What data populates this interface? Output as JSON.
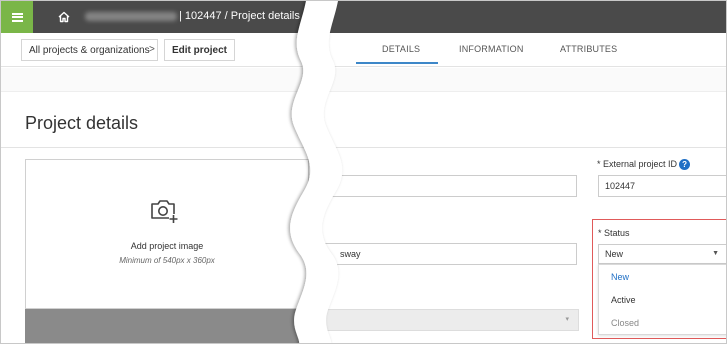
{
  "topbar": {
    "breadcrumb_text": "| 102447  /  Project details"
  },
  "nav": {
    "back_link": "All projects & organizations",
    "chevron": ">",
    "edit_project": "Edit project",
    "tabs": [
      {
        "label": "DETAILS",
        "active": true
      },
      {
        "label": "INFORMATION",
        "active": false
      },
      {
        "label": "ATTRIBUTES",
        "active": false
      }
    ]
  },
  "section": {
    "title": "Project details"
  },
  "image_panel": {
    "add_label": "Add project image",
    "min_size": "Minimum of 540px x 360px",
    "icon": "camera-plus-icon"
  },
  "fields": {
    "external_id": {
      "label": "* External project ID",
      "value": "102447"
    },
    "truncated_value": "sway",
    "status": {
      "label": "* Status",
      "value": "New",
      "options": [
        {
          "label": "New",
          "selected": true
        },
        {
          "label": "Active",
          "selected": false
        },
        {
          "label": "Closed",
          "selected": false
        }
      ]
    }
  },
  "colors": {
    "topbar": "#4a4a4a",
    "menu_accent": "#7ab648",
    "tab_active": "#3d87c8",
    "help_icon": "#1f6fc5",
    "highlight_border": "#e05a5a",
    "selected_option": "#1f6fc5"
  }
}
